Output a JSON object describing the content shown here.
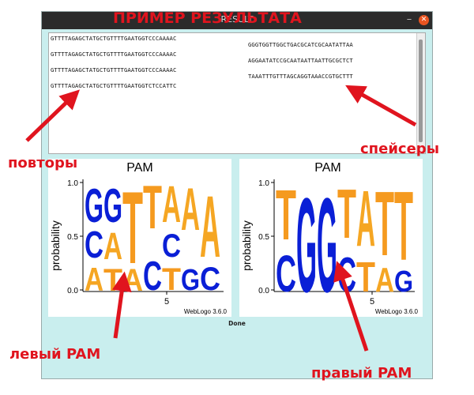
{
  "window": {
    "title": "RESULT",
    "minimize_glyph": "–",
    "close_glyph": "✕",
    "background_color": "#c9eeee"
  },
  "output": {
    "repeats": [
      "GTTTTAGAGCTATGCTGTTTTGAATGGTCCCAAAAC",
      "GTTTTAGAGCTATGCTGTTTTGAATGGTCCCAAAAC",
      "GTTTTAGAGCTATGCTGTTTTGAATGGTCCCAAAAC",
      "GTTTTAGAGCTATGCTGTTTTGAATGGTCTCCATTC"
    ],
    "spacers": [
      "GGGTGGTTGGCTGACGCATCGCAATATTAA",
      "AGGAATATCCGCAATAATTAATTGCGCTCT",
      "TAAATTTGTTTAGCAGGTAAACCGTGCTTT"
    ]
  },
  "logos": {
    "left": {
      "title": "PAM",
      "ylabel": "probability",
      "yticks": [
        "0.0",
        "0.5",
        "1.0"
      ],
      "xtick": "5",
      "credit": "WebLogo 3.6.0"
    },
    "right": {
      "title": "PAM",
      "ylabel": "probability",
      "yticks": [
        "0.0",
        "0.5",
        "1.0"
      ],
      "xtick": "5",
      "credit": "WebLogo 3.6.0"
    }
  },
  "status": {
    "done_label": "Done"
  },
  "annotations": {
    "top": "ПРИМЕР РЕЗУЛЬТАТА",
    "repeats": "повторы",
    "spacers": "спейсеры",
    "left_pam": "левый PAM",
    "right_pam": "правый PAM",
    "color": "#e0141e"
  },
  "nucleotide_colors": {
    "A": "#f5a623",
    "C": "#0a1fd6",
    "G": "#0a1fd6",
    "T": "#f59a1f"
  }
}
